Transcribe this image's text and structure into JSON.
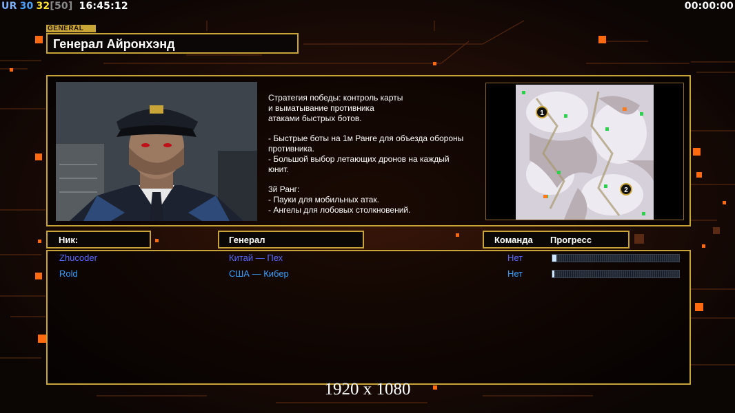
{
  "hud": {
    "ur_label": "UR",
    "fps": "30",
    "load": "32",
    "max": "[50]",
    "clock": "16:45:12",
    "timer": "00:00:00"
  },
  "header": {
    "tag": "GENERAL",
    "title": "Генерал Айронхэнд"
  },
  "info": {
    "description": "Стратегия победы: контроль карты\nи выматывание противника\nатаками быстрых ботов.\n\n- Быстрые боты на 1м Ранге для объезда обороны\n противника.\n- Большой выбор летающих дронов на каждый\n юнит.\n\n3й Ранг:\n- Пауки для мобильных атак.\n- Ангелы для лобовых столкновений.",
    "map_markers": [
      "1",
      "2"
    ]
  },
  "columns": {
    "nick": "Ник:",
    "general": "Генерал",
    "team": "Команда",
    "progress": "Прогресс"
  },
  "players": [
    {
      "nick": "Zhucoder",
      "general": "Китай — Пех",
      "team": "Нет",
      "progress": 0.03,
      "color": "#5a6cff"
    },
    {
      "nick": "Rold",
      "general": "США — Кибер",
      "team": "Нет",
      "progress": 0.015,
      "color": "#3aa0ff"
    }
  ],
  "resolution": "1920 x 1080",
  "colors": {
    "frame": "#c9a437",
    "accent_orange": "#ff7a1a"
  }
}
